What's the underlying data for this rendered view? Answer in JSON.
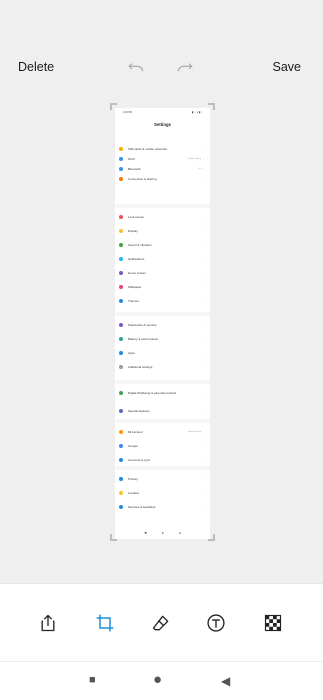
{
  "header": {
    "delete_label": "Delete",
    "save_label": "Save"
  },
  "preview": {
    "status": {
      "time": "4:26 PM",
      "icons": "◧ ◔ ▾ ▮ ▯"
    },
    "title": "Settings",
    "groups": [
      [
        {
          "label": "SIM cards & mobile networks",
          "value": "",
          "icon_color": "#f5b100"
        },
        {
          "label": "Wi-Fi",
          "value": "Project_Sling",
          "icon_color": "#3b8ff6"
        },
        {
          "label": "Bluetooth",
          "value": "On",
          "icon_color": "#3b8ff6"
        },
        {
          "label": "Connection & sharing",
          "value": "",
          "icon_color": "#f57c00"
        }
      ],
      [
        {
          "label": "Lock screen",
          "value": "",
          "icon_color": "#ef5350"
        },
        {
          "label": "Display",
          "value": "",
          "icon_color": "#fbc02d"
        },
        {
          "label": "Sound & vibration",
          "value": "",
          "icon_color": "#43a047"
        },
        {
          "label": "Notifications",
          "value": "",
          "icon_color": "#29b6f6"
        },
        {
          "label": "Home screen",
          "value": "",
          "icon_color": "#7e57c2"
        },
        {
          "label": "Wallpaper",
          "value": "",
          "icon_color": "#ec407a"
        },
        {
          "label": "Themes",
          "value": "",
          "icon_color": "#1e88e5"
        }
      ],
      [
        {
          "label": "Passwords & security",
          "value": "",
          "icon_color": "#7e57c2"
        },
        {
          "label": "Battery & performance",
          "value": "",
          "icon_color": "#26a69a"
        },
        {
          "label": "Apps",
          "value": "",
          "icon_color": "#1e88e5"
        },
        {
          "label": "Additional settings",
          "value": "",
          "icon_color": "#9e9e9e"
        }
      ],
      [
        {
          "label": "Digital Wellbeing & parental controls",
          "value": "",
          "icon_color": "#43a047"
        },
        {
          "label": "Special features",
          "value": "",
          "icon_color": "#5c6bc0"
        }
      ],
      [
        {
          "label": "Mi Account",
          "value": "Gurpreet Sha",
          "icon_color": "#ff9800"
        },
        {
          "label": "Google",
          "value": "",
          "icon_color": "#4285f4"
        },
        {
          "label": "Accounts & sync",
          "value": "",
          "icon_color": "#1e88e5"
        }
      ],
      [
        {
          "label": "Privacy",
          "value": "",
          "icon_color": "#1e88e5"
        },
        {
          "label": "Location",
          "value": "",
          "icon_color": "#fbc02d"
        },
        {
          "label": "Services & feedback",
          "value": "",
          "icon_color": "#1e88e5"
        }
      ]
    ],
    "nav": {
      "square": "■",
      "circle": "●",
      "back": "◂"
    }
  },
  "toolbar": {
    "tools": [
      {
        "name": "share-icon"
      },
      {
        "name": "crop-icon",
        "active": true
      },
      {
        "name": "eraser-icon"
      },
      {
        "name": "text-icon"
      },
      {
        "name": "mosaic-icon"
      }
    ],
    "accent": "#1a8fd8"
  },
  "system_nav": {
    "recent": "■",
    "home": "●",
    "back": "◀"
  }
}
